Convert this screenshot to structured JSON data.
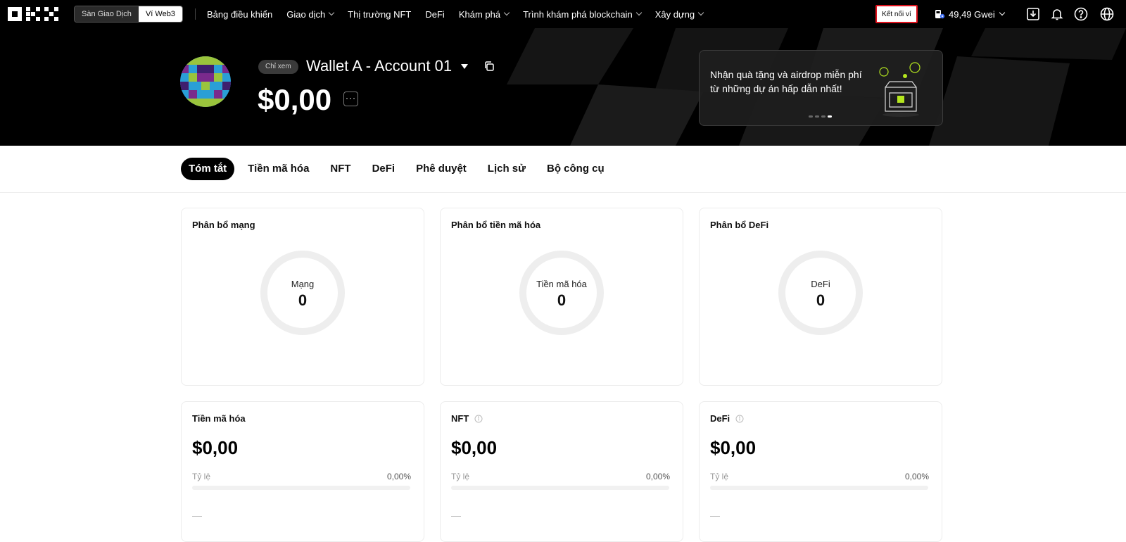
{
  "nav": {
    "mode_exchange": "Sàn Giao Dịch",
    "mode_web3": "Ví Web3",
    "links": [
      {
        "label": "Bảng điều khiển",
        "dropdown": false
      },
      {
        "label": "Giao dịch",
        "dropdown": true
      },
      {
        "label": "Thị trường NFT",
        "dropdown": false
      },
      {
        "label": "DeFi",
        "dropdown": false
      },
      {
        "label": "Khám phá",
        "dropdown": true
      },
      {
        "label": "Trình khám phá blockchain",
        "dropdown": true
      },
      {
        "label": "Xây dựng",
        "dropdown": true
      }
    ],
    "connect_wallet": "Kết nối ví",
    "gas": "49,49 Gwei",
    "icons": [
      "download-icon",
      "bell-icon",
      "help-icon",
      "globe-icon"
    ]
  },
  "hero": {
    "view_only_badge": "Chỉ xem",
    "wallet_name": "Wallet A - Account 01",
    "balance": "$0,00",
    "more": "···",
    "promo_text": "Nhận quà tặng và airdrop miễn phí từ những dự án hấp dẫn nhất!",
    "promo_active_slide": 4,
    "promo_total_slides": 4
  },
  "tabs": [
    "Tóm tắt",
    "Tiền mã hóa",
    "NFT",
    "DeFi",
    "Phê duyệt",
    "Lịch sử",
    "Bộ công cụ"
  ],
  "active_tab": 0,
  "distribution_cards": [
    {
      "title": "Phân bổ mạng",
      "center_label": "Mạng",
      "center_value": "0"
    },
    {
      "title": "Phân bổ tiền mã hóa",
      "center_label": "Tiền mã hóa",
      "center_value": "0"
    },
    {
      "title": "Phân bổ DeFi",
      "center_label": "DeFi",
      "center_value": "0"
    }
  ],
  "value_cards": [
    {
      "title": "Tiền mã hóa",
      "info": false,
      "amount": "$0,00",
      "ratio_label": "Tỷ lệ",
      "ratio_value": "0,00%",
      "ratio_fraction": 0,
      "placeholder": "—"
    },
    {
      "title": "NFT",
      "info": true,
      "amount": "$0,00",
      "ratio_label": "Tỷ lệ",
      "ratio_value": "0,00%",
      "ratio_fraction": 0,
      "placeholder": "—"
    },
    {
      "title": "DeFi",
      "info": true,
      "amount": "$0,00",
      "ratio_label": "Tỷ lệ",
      "ratio_value": "0,00%",
      "ratio_fraction": 0,
      "placeholder": "—"
    }
  ],
  "colors": {
    "connect_border": "#e0121d",
    "nav_bg": "#000000",
    "accent": "#000000"
  }
}
